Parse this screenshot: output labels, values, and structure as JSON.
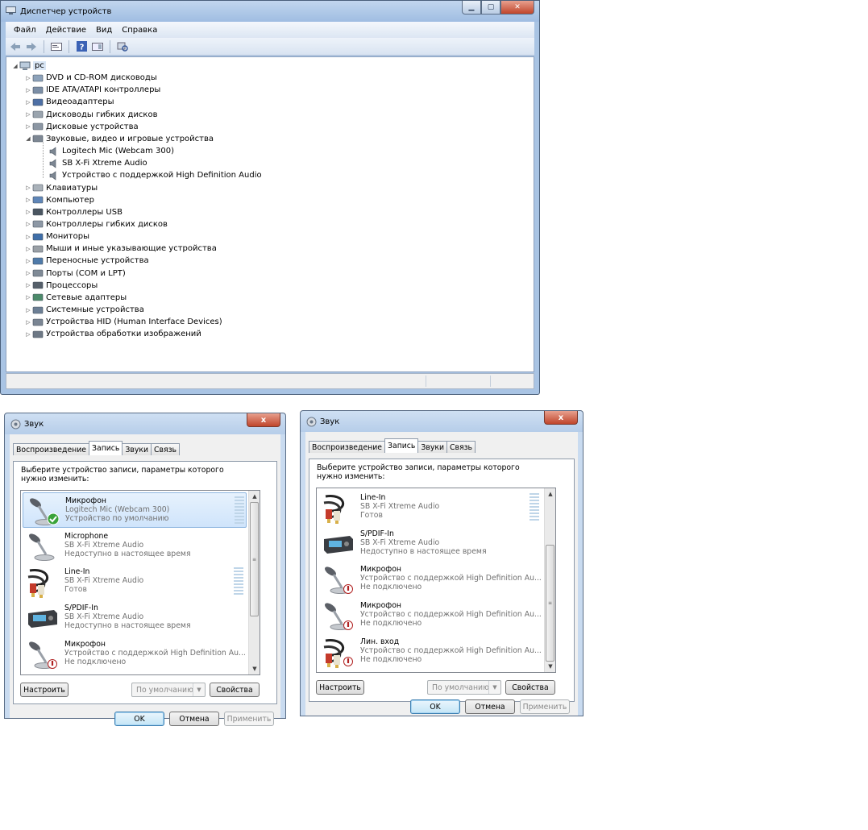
{
  "device_manager": {
    "title": "Диспетчер устройств",
    "menu": [
      "Файл",
      "Действие",
      "Вид",
      "Справка"
    ],
    "toolbar_icons": [
      "back-arrow-icon",
      "forward-arrow-icon",
      "properties-icon",
      "help-icon",
      "show-hidden-icon",
      "scan-hardware-icon"
    ],
    "tree": {
      "root": "pc",
      "items": [
        {
          "label": "DVD и CD-ROM дисководы",
          "icon": "dvd-drive-icon"
        },
        {
          "label": "IDE ATA/ATAPI контроллеры",
          "icon": "ide-controller-icon"
        },
        {
          "label": "Видеоадаптеры",
          "icon": "display-adapter-icon"
        },
        {
          "label": "Дисководы гибких дисков",
          "icon": "floppy-drive-icon"
        },
        {
          "label": "Дисковые устройства",
          "icon": "disk-drive-icon"
        },
        {
          "label": "Звуковые, видео и игровые устройства",
          "icon": "speaker-icon",
          "expanded": true,
          "children": [
            "Logitech Mic (Webcam 300)",
            "SB X-Fi Xtreme Audio",
            "Устройство с поддержкой High Definition Audio"
          ]
        },
        {
          "label": "Клавиатуры",
          "icon": "keyboard-icon"
        },
        {
          "label": "Компьютер",
          "icon": "computer-icon"
        },
        {
          "label": "Контроллеры USB",
          "icon": "usb-icon"
        },
        {
          "label": "Контроллеры гибких дисков",
          "icon": "floppy-controller-icon"
        },
        {
          "label": "Мониторы",
          "icon": "monitor-icon"
        },
        {
          "label": "Мыши и иные указывающие устройства",
          "icon": "mouse-icon"
        },
        {
          "label": "Переносные устройства",
          "icon": "portable-device-icon"
        },
        {
          "label": "Порты (COM и LPT)",
          "icon": "port-icon"
        },
        {
          "label": "Процессоры",
          "icon": "processor-icon"
        },
        {
          "label": "Сетевые адаптеры",
          "icon": "network-adapter-icon"
        },
        {
          "label": "Системные устройства",
          "icon": "system-device-icon"
        },
        {
          "label": "Устройства HID (Human Interface Devices)",
          "icon": "hid-icon"
        },
        {
          "label": "Устройства обработки изображений",
          "icon": "imaging-device-icon"
        }
      ]
    }
  },
  "sound_left": {
    "title": "Звук",
    "close": "x",
    "tabs": [
      "Воспроизведение",
      "Запись",
      "Звуки",
      "Связь"
    ],
    "active_tab": "Запись",
    "instruction": "Выберите устройство записи, параметры которого нужно изменить:",
    "devices": [
      {
        "name": "Микрофон",
        "driver": "Logitech Mic (Webcam 300)",
        "state": "Устройство по умолчанию",
        "icon": "microphone-icon",
        "default": true
      },
      {
        "name": "Microphone",
        "driver": "SB X-Fi Xtreme Audio",
        "state": "Недоступно в настоящее время",
        "icon": "microphone-icon"
      },
      {
        "name": "Line-In",
        "driver": "SB X-Fi Xtreme Audio",
        "state": "Готов",
        "icon": "rca-cable-icon"
      },
      {
        "name": "S/PDIF-In",
        "driver": "SB X-Fi Xtreme Audio",
        "state": "Недоступно в настоящее время",
        "icon": "spdif-device-icon"
      },
      {
        "name": "Микрофон",
        "driver": "Устройство с поддержкой High Definition Au...",
        "state": "Не подключено",
        "icon": "microphone-icon"
      }
    ],
    "buttons": {
      "configure": "Настроить",
      "default": "По умолчанию",
      "properties": "Свойства",
      "ok": "OK",
      "cancel": "Отмена",
      "apply": "Применить"
    }
  },
  "sound_right": {
    "title": "Звук",
    "close": "x",
    "tabs": [
      "Воспроизведение",
      "Запись",
      "Звуки",
      "Связь"
    ],
    "active_tab": "Запись",
    "instruction": "Выберите устройство записи, параметры которого нужно изменить:",
    "devices": [
      {
        "name": "Line-In",
        "driver": "SB X-Fi Xtreme Audio",
        "state": "Готов",
        "icon": "rca-cable-icon"
      },
      {
        "name": "S/PDIF-In",
        "driver": "SB X-Fi Xtreme Audio",
        "state": "Недоступно в настоящее время",
        "icon": "spdif-device-icon"
      },
      {
        "name": "Микрофон",
        "driver": "Устройство с поддержкой High Definition Au...",
        "state": "Не подключено",
        "icon": "microphone-icon"
      },
      {
        "name": "Микрофон",
        "driver": "Устройство с поддержкой High Definition Au...",
        "state": "Не подключено",
        "icon": "microphone-icon"
      },
      {
        "name": "Лин. вход",
        "driver": "Устройство с поддержкой High Definition Au...",
        "state": "Не подключено",
        "icon": "rca-cable-icon"
      }
    ],
    "buttons": {
      "configure": "Настроить",
      "default": "По умолчанию",
      "properties": "Свойства",
      "ok": "OK",
      "cancel": "Отмена",
      "apply": "Применить"
    }
  },
  "colors": {
    "titlebar": "#b6cde9",
    "selection": "#cfe4fb",
    "close_button": "#c0452b",
    "level_meter": "#bfd5e8"
  }
}
